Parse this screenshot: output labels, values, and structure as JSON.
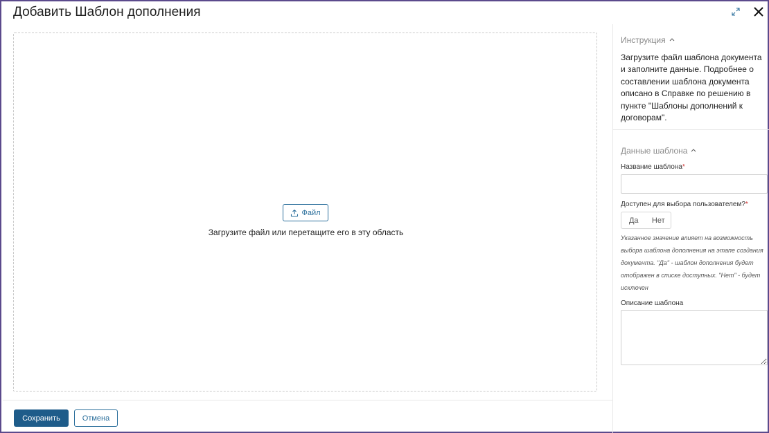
{
  "dialog": {
    "title": "Добавить Шаблон дополнения"
  },
  "upload": {
    "file_button_label": "Файл",
    "hint": "Загрузите файл или перетащите его в эту область"
  },
  "footer": {
    "save_label": "Сохранить",
    "cancel_label": "Отмена"
  },
  "sidebar": {
    "instruction": {
      "header": "Инструкция",
      "text": "Загрузите файл шаблона документа и заполните данные. Подробнее о составлении шаблона документа описано в Справке по решению в пункте \"Шаблоны дополнений к договорам\"."
    },
    "template_data": {
      "header": "Данные шаблона",
      "name_label": "Название шаблона",
      "name_value": "",
      "available_label": "Доступен для выбора пользователем?",
      "option_yes": "Да",
      "option_no": "Нет",
      "available_hint": "Указанное значение влияет на возможность выбора шаблона дополнения на этапе создания документа. \"Да\" - шаблон дополнения будет отображен в списке доступных. \"Нет\" - будет исключен",
      "description_label": "Описание шаблона",
      "description_value": "",
      "required_mark": "*"
    }
  },
  "icons": {
    "expand": "expand-icon",
    "close": "close-icon",
    "upload": "upload-icon",
    "collapse": "chevron-up-icon"
  },
  "colors": {
    "primary": "#1e5c8a",
    "link": "#2a6e9b",
    "required": "#d03232",
    "frame": "#5b4a8c"
  }
}
